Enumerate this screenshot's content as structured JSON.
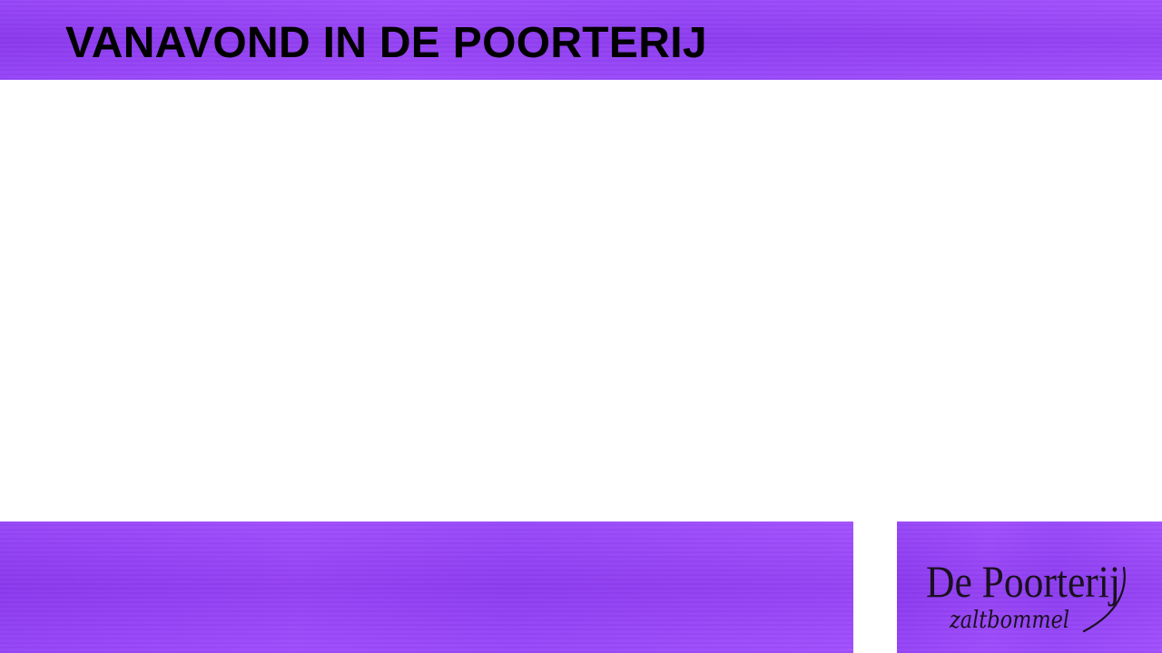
{
  "slide": {
    "title": "VANAVOND IN DE POORTERIJ"
  },
  "logo": {
    "name": "De Poorterij",
    "subtitle": "zaltbommel",
    "icon": "de-poorterij-logo"
  },
  "colors": {
    "band": "#9540f9",
    "band_dark": "#8a38f0",
    "title_text": "#000000",
    "logo_ink": "#1a1020",
    "background": "#ffffff"
  }
}
